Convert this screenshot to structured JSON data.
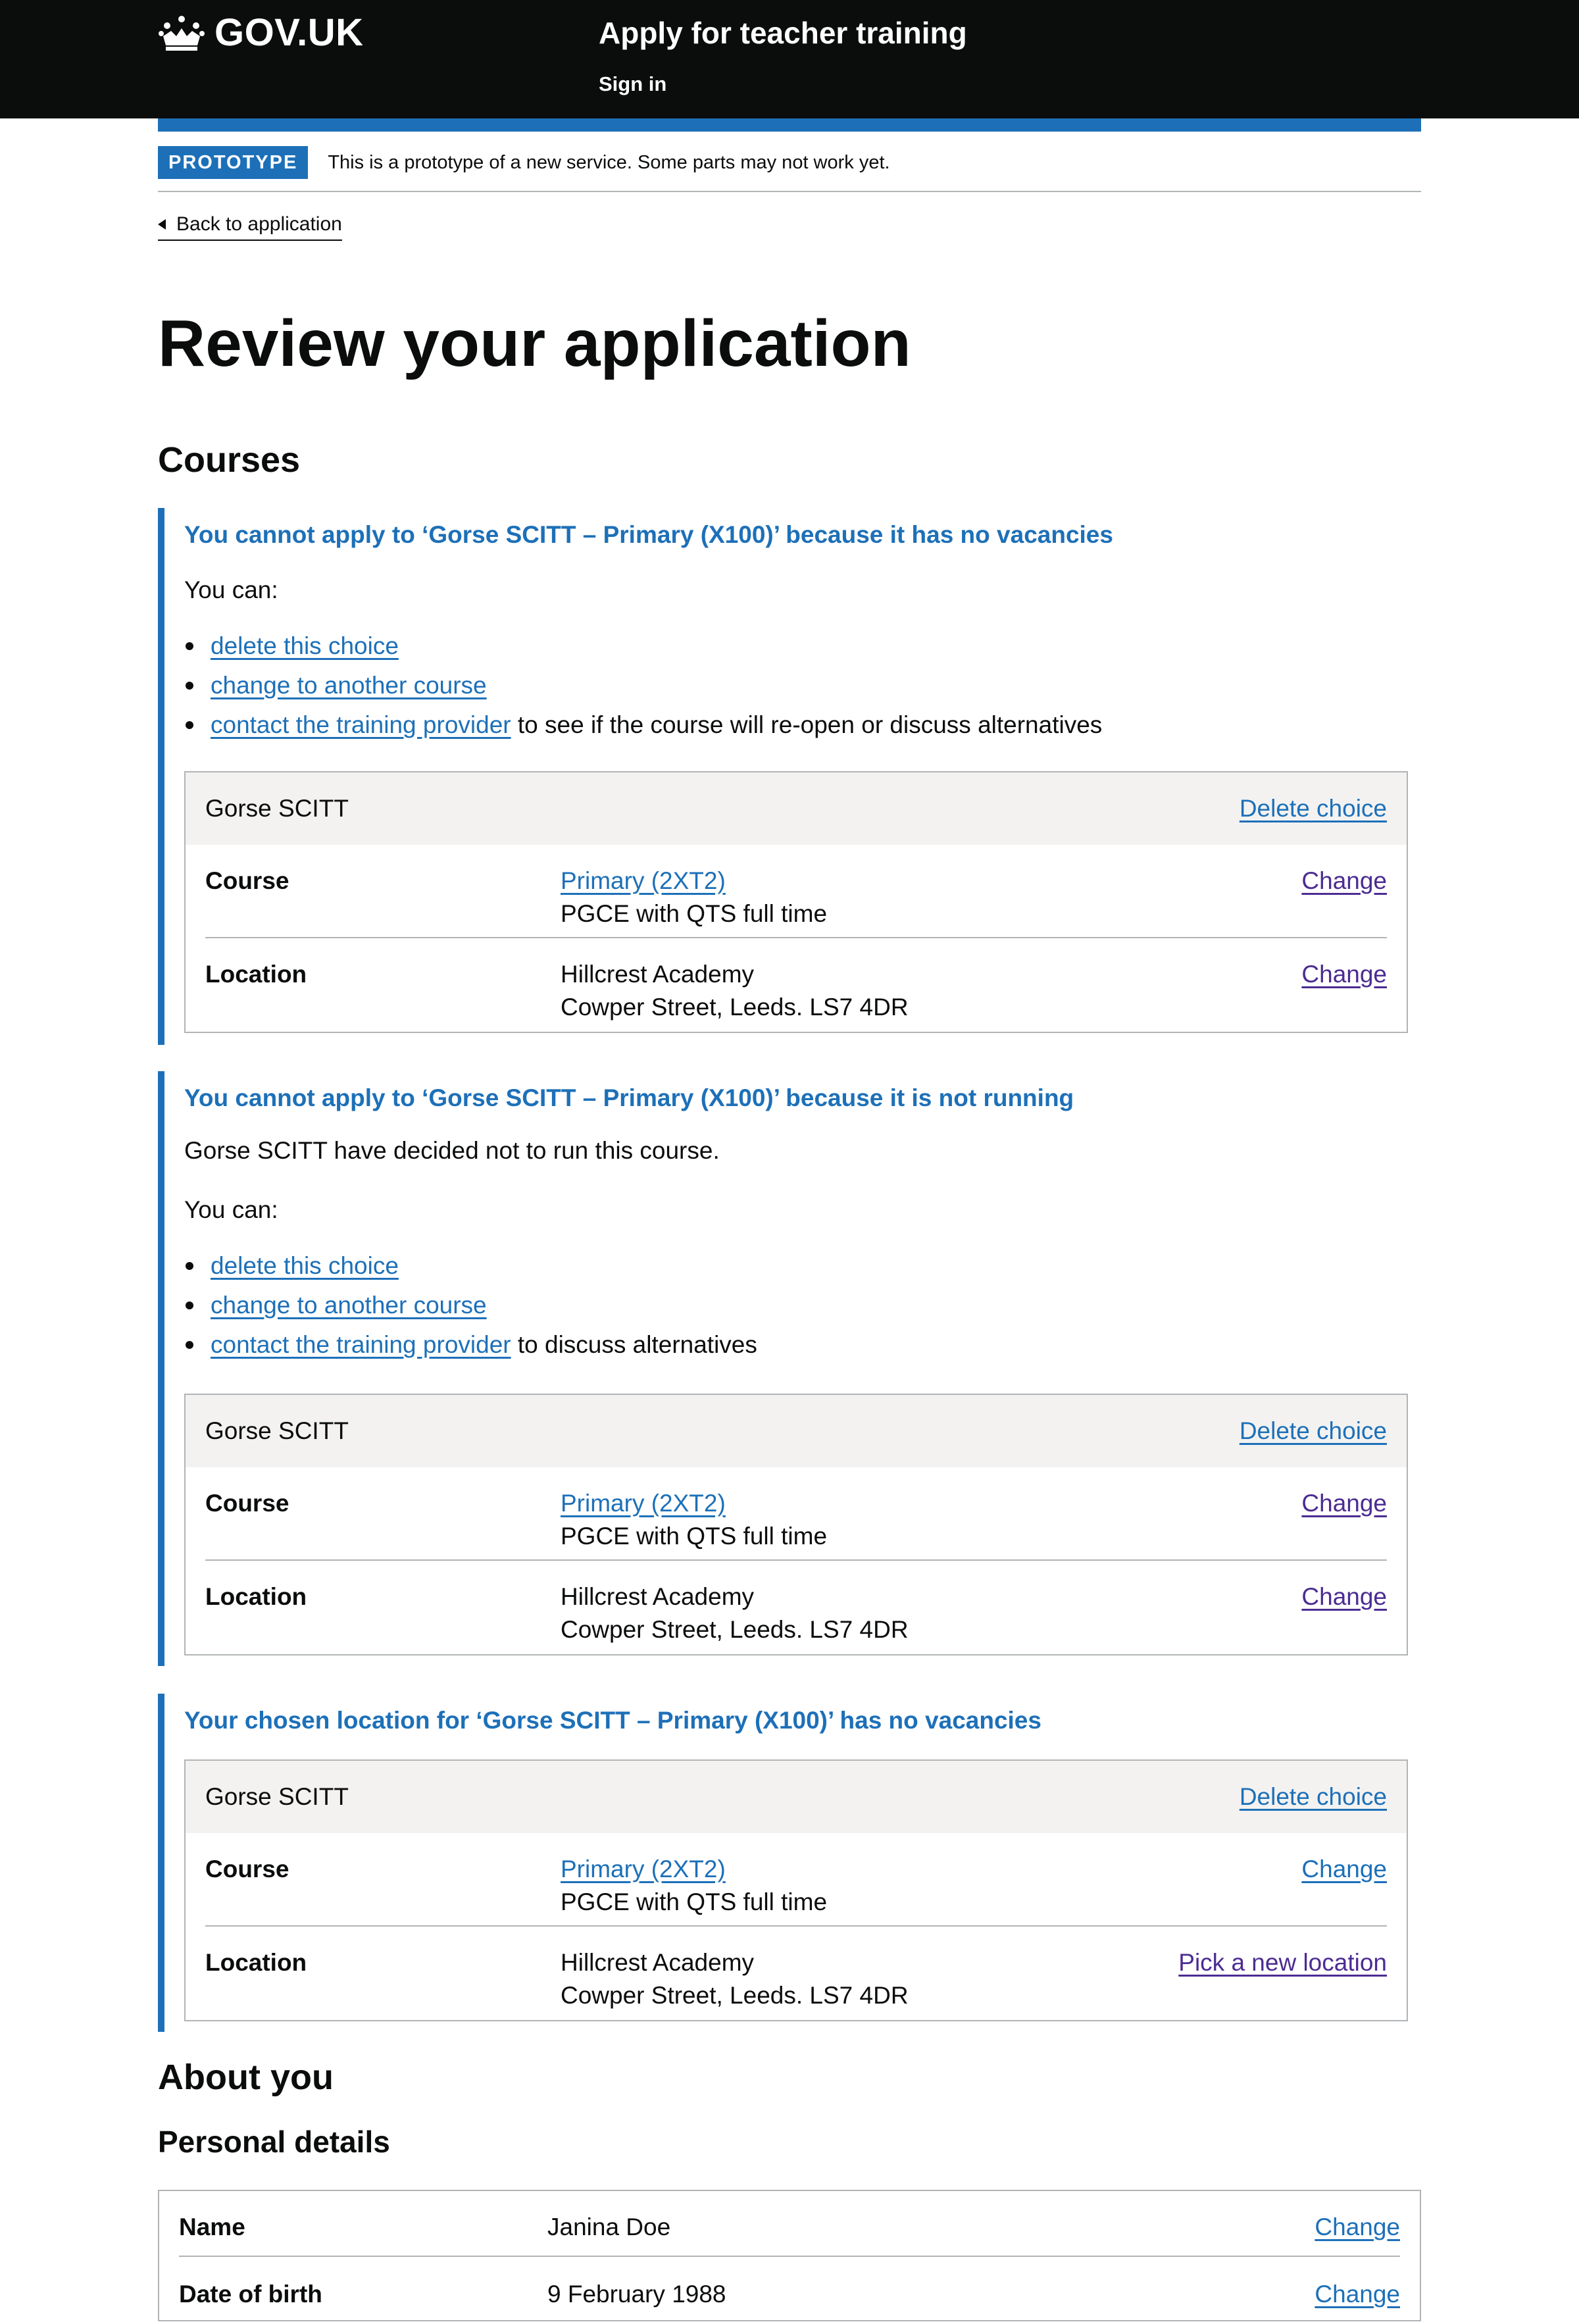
{
  "header": {
    "logo_text": "GOV.UK",
    "service_name": "Apply for teacher training",
    "sign_in": "Sign in"
  },
  "phase_banner": {
    "tag": "PROTOTYPE",
    "text": "This is a prototype of a new service. Some parts may not work yet."
  },
  "back_link": "Back to application",
  "page_title": "Review your application",
  "courses_heading": "Courses",
  "blocks": [
    {
      "heading": "You cannot apply to ‘Gorse SCITT – Primary (X100)’ because it has no vacancies",
      "you_can": "You can:",
      "options": [
        {
          "link": "delete this choice",
          "suffix": ""
        },
        {
          "link": "change to another course",
          "suffix": ""
        },
        {
          "link": "contact the training provider",
          "suffix": " to see if the course will re-open or discuss alternatives"
        }
      ],
      "card": {
        "title": "Gorse SCITT",
        "action": "Delete choice",
        "course_key": "Course",
        "course_link": "Primary (2XT2)",
        "course_detail": "PGCE with QTS full time",
        "course_action": "Change",
        "location_key": "Location",
        "location_name": "Hillcrest Academy",
        "location_address": "Cowper Street, Leeds. LS7 4DR",
        "location_action": "Change"
      }
    },
    {
      "heading": "You cannot apply to ‘Gorse SCITT – Primary (X100)’ because it is not running",
      "intro": "Gorse SCITT have decided not to run this course.",
      "you_can": "You can:",
      "options": [
        {
          "link": "delete this choice",
          "suffix": ""
        },
        {
          "link": "change to another course",
          "suffix": ""
        },
        {
          "link": "contact the training provider",
          "suffix": " to discuss alternatives"
        }
      ],
      "card": {
        "title": "Gorse SCITT",
        "action": "Delete choice",
        "course_key": "Course",
        "course_link": "Primary (2XT2)",
        "course_detail": "PGCE with QTS full time",
        "course_action": "Change",
        "location_key": "Location",
        "location_name": "Hillcrest Academy",
        "location_address": "Cowper Street, Leeds. LS7 4DR",
        "location_action": "Change"
      }
    },
    {
      "heading": "Your chosen location for ‘Gorse SCITT – Primary (X100)’ has no vacancies",
      "card": {
        "title": "Gorse SCITT",
        "action": "Delete choice",
        "course_key": "Course",
        "course_link": "Primary (2XT2)",
        "course_detail": "PGCE with QTS full time",
        "course_action": "Change",
        "location_key": "Location",
        "location_name": "Hillcrest Academy",
        "location_address": "Cowper Street, Leeds. LS7 4DR",
        "location_action": "Pick a new location"
      }
    }
  ],
  "about_heading": "About you",
  "personal_heading": "Personal details",
  "personal_rows": [
    {
      "key": "Name",
      "value": "Janina Doe",
      "action": "Change"
    },
    {
      "key": "Date of birth",
      "value": "9 February 1988",
      "action": "Change"
    }
  ],
  "colors": {
    "header_bg": "#0b0c0c",
    "brand_blue": "#1d70b8",
    "visited_link": "#4c2c92",
    "card_head_bg": "#f3f2f1",
    "border_grey": "#b1b4b6"
  }
}
